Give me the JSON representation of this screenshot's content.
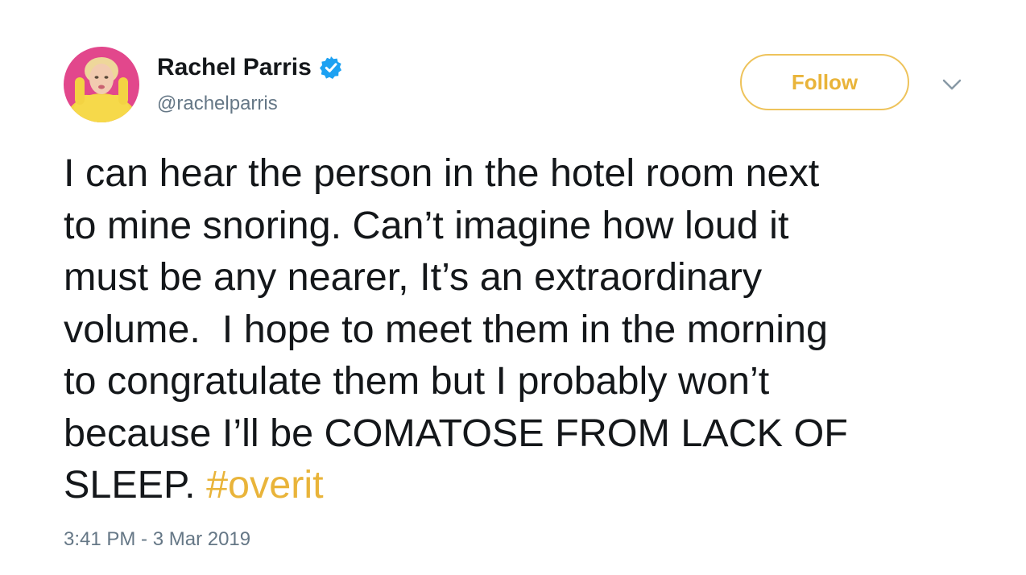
{
  "author": {
    "name": "Rachel Parris",
    "handle": "@rachelparris",
    "verified": true,
    "verified_color": "#1da1f2"
  },
  "follow_button": {
    "label": "Follow",
    "accent": "#e9b43a"
  },
  "menu": {
    "icon": "chevron-down-icon"
  },
  "tweet": {
    "text_lines": [
      "I can hear the person in the hotel room next",
      "to mine snoring. Can’t imagine how loud it",
      "must be any nearer, It’s an extraordinary",
      "volume.  I hope to meet them in the morning",
      "to congratulate them but I probably won’t",
      "because I’ll be COMATOSE FROM LACK OF",
      "SLEEP. "
    ],
    "hashtag": "#overit",
    "timestamp": "3:41 PM - 3 Mar 2019"
  }
}
